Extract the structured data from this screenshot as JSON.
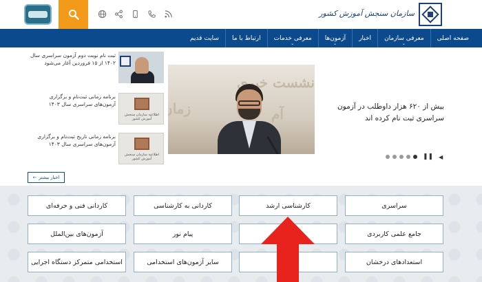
{
  "header": {
    "org_name": "سازمان سنجش آموزش کشور",
    "icons": [
      "rss-icon",
      "phone-icon",
      "mobile-icon",
      "share-icon",
      "globe-icon"
    ]
  },
  "nav": {
    "items": [
      {
        "label": "صفحه اصلی",
        "has_dropdown": false
      },
      {
        "label": "معرفی سازمان",
        "has_dropdown": true
      },
      {
        "label": "اخبار",
        "has_dropdown": false
      },
      {
        "label": "آزمون‌ها",
        "has_dropdown": true
      },
      {
        "label": "معرفی خدمات",
        "has_dropdown": true
      },
      {
        "label": "ارتباط با ما",
        "has_dropdown": false
      },
      {
        "label": "سایت قدیم",
        "has_dropdown": false
      }
    ]
  },
  "news": {
    "main_headline": "بیش از ۶۲۰ هزار داوطلب در آزمون سراسری ثبت نام کرده اند",
    "side_items": [
      {
        "text": "ثبت نام نوبت دوم آزمون سراسری سال ۱۴۰۲ از ۱۵ فروردین آغاز می‌شود"
      },
      {
        "text": "برنامه زمانی ثبت‌نام و برگزاری آزمون‌های سراسری سال ۱۴۰۳"
      },
      {
        "text": "برنامه زمانی تاریخ ثبت‌نام و برگزاری آزمون‌های سراسری سال ۱۴۰۳"
      }
    ],
    "thumb_caption": "اطلاعیه سازمان سنجش آموزش کشور",
    "slider_dots": 5,
    "more_label": "اخبار بیشتر"
  },
  "tiles": {
    "row1": [
      "سراسری",
      "کارشناسی ارشد",
      "کاردانی به کارشناسی",
      "کاردانی فنی و حرفه‌ای"
    ],
    "row2": [
      "جامع علمی کاربردی",
      "",
      "پیام نور",
      "آزمون‌های بین‌الملل"
    ],
    "row3": [
      "استعدادهای درخشان",
      "",
      "سایر آزمون‌های استخدامی",
      "استخدامی متمرکز دستگاه اجرایی"
    ]
  },
  "colors": {
    "nav_bg": "#0c4a8e",
    "search_bg": "#f49a1a",
    "tile_border": "#8db0cf",
    "arrow": "#e8221c"
  }
}
